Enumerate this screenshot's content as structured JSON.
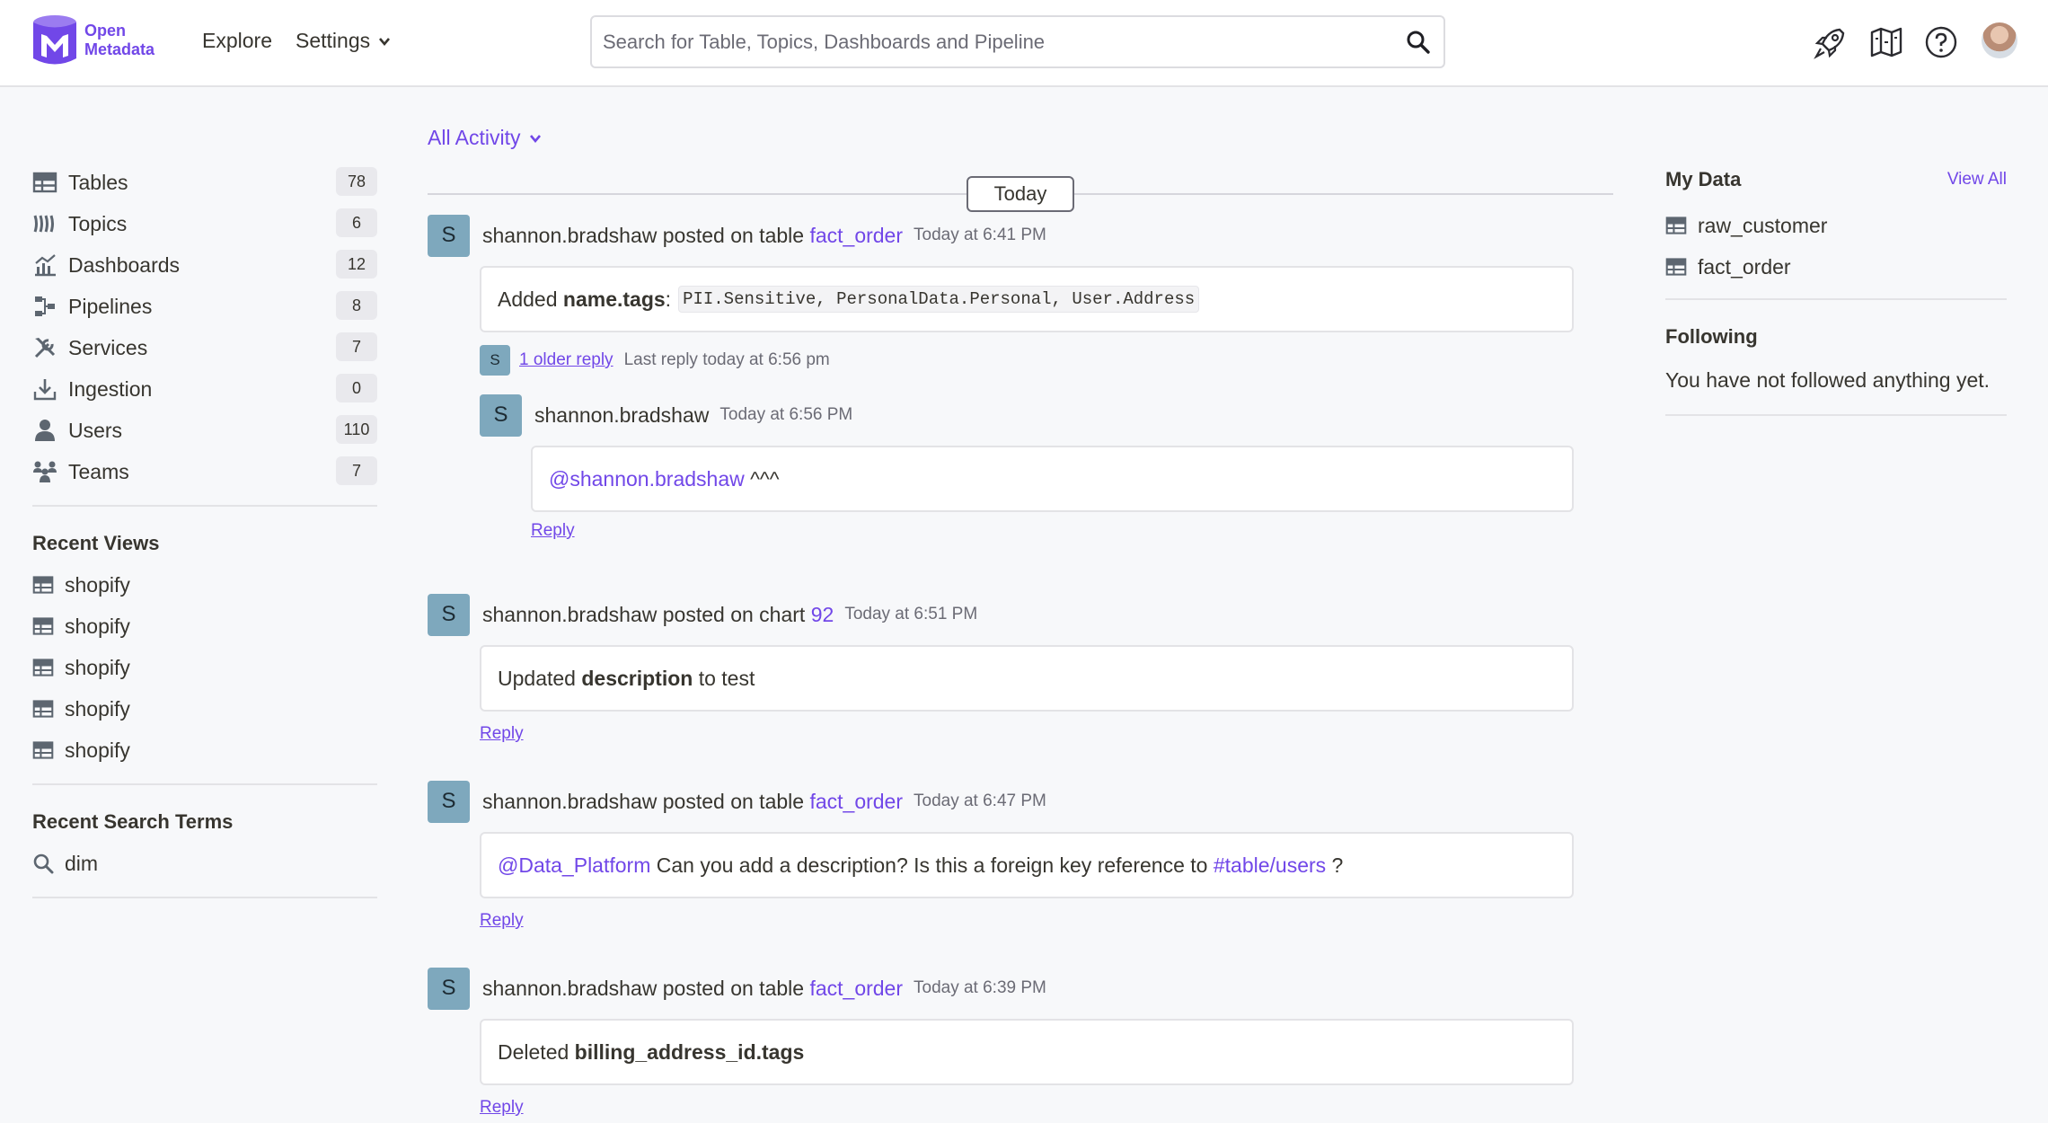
{
  "header": {
    "logo_line1": "Open",
    "logo_line2": "Metadata",
    "nav_explore": "Explore",
    "nav_settings": "Settings",
    "search_placeholder": "Search for Table, Topics, Dashboards and Pipeline",
    "icons": [
      "rocket-icon",
      "map-icon",
      "help-icon",
      "user-avatar"
    ]
  },
  "sidebar": {
    "entities": [
      {
        "label": "Tables",
        "count": "78",
        "icon": "table-icon"
      },
      {
        "label": "Topics",
        "count": "6",
        "icon": "topic-icon"
      },
      {
        "label": "Dashboards",
        "count": "12",
        "icon": "dashboard-icon"
      },
      {
        "label": "Pipelines",
        "count": "8",
        "icon": "pipeline-icon"
      },
      {
        "label": "Services",
        "count": "7",
        "icon": "services-icon"
      },
      {
        "label": "Ingestion",
        "count": "0",
        "icon": "ingestion-icon"
      },
      {
        "label": "Users",
        "count": "110",
        "icon": "user-icon"
      },
      {
        "label": "Teams",
        "count": "7",
        "icon": "teams-icon"
      }
    ],
    "recent_views_title": "Recent Views",
    "recent_views": [
      "shopify",
      "shopify",
      "shopify",
      "shopify",
      "shopify"
    ],
    "recent_search_title": "Recent Search Terms",
    "recent_search": [
      "dim"
    ]
  },
  "feed": {
    "filter_label": "All Activity",
    "day_label": "Today",
    "posts": [
      {
        "avatar": "S",
        "user": "shannon.bradshaw",
        "action": " posted on table ",
        "entity": "fact_order",
        "time": "Today at 6:41 PM",
        "msg_prefix": "Added ",
        "msg_bold": "name.tags",
        "msg_suffix": ":",
        "msg_code": "PII.Sensitive, PersonalData.Personal, User.Address",
        "older_avatar": "S",
        "older_link": "1 older reply",
        "older_last": "Last reply today at 6:56 pm",
        "reply": {
          "avatar": "S",
          "user": "shannon.bradshaw",
          "time": "Today at 6:56 PM",
          "mention": "@shannon.bradshaw",
          "text": " ^^^",
          "reply_label": "Reply"
        }
      },
      {
        "avatar": "S",
        "user": "shannon.bradshaw",
        "action": " posted on chart ",
        "entity": "92",
        "time": "Today at 6:51 PM",
        "msg_prefix": "Updated ",
        "msg_bold": "description",
        "msg_suffix": " to test",
        "reply_label": "Reply"
      },
      {
        "avatar": "S",
        "user": "shannon.bradshaw",
        "action": " posted on table ",
        "entity": "fact_order",
        "time": "Today at 6:47 PM",
        "mention": "@Data_Platform",
        "text": " Can you add a description? Is this a foreign key reference to ",
        "hashtag": "#table/users",
        "tail": " ?",
        "reply_label": "Reply"
      },
      {
        "avatar": "S",
        "user": "shannon.bradshaw",
        "action": " posted on table ",
        "entity": "fact_order",
        "time": "Today at 6:39 PM",
        "msg_prefix": "Deleted ",
        "msg_bold": "billing_address_id.tags",
        "reply_label": "Reply"
      }
    ]
  },
  "right": {
    "my_data_title": "My Data",
    "view_all": "View All",
    "my_data": [
      "raw_customer",
      "fact_order"
    ],
    "following_title": "Following",
    "following_msg": "You have not followed anything yet."
  },
  "colors": {
    "accent": "#7147e8",
    "avatar_bg": "#7ea8bd",
    "page_bg": "#f7f8fa"
  }
}
